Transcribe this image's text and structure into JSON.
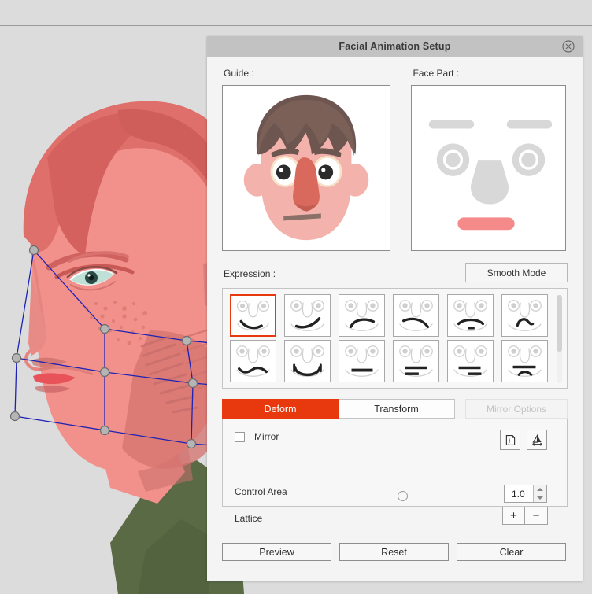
{
  "dialog": {
    "title": "Facial Animation Setup",
    "close_icon": "close-circle-icon"
  },
  "guide": {
    "label": "Guide :",
    "image_alt": "cartoon-face-guide"
  },
  "face_part": {
    "label": "Face Part :",
    "image_alt": "face-part-selector",
    "selected_part": "mouth",
    "selected_color": "#f58a8a",
    "part_color": "#d8d8d8"
  },
  "expression": {
    "label": "Expression :",
    "smooth_mode_label": "Smooth Mode",
    "selected_index": 0,
    "items": [
      {
        "name": "smile-soft",
        "shape": "curve-down-thick-left"
      },
      {
        "name": "smile-wide",
        "shape": "curve-up-right"
      },
      {
        "name": "smirk-left",
        "shape": "arc-up-left"
      },
      {
        "name": "smirk-right",
        "shape": "arc-up-right"
      },
      {
        "name": "open-small",
        "shape": "arc-with-dot"
      },
      {
        "name": "wave-small",
        "shape": "s-curve-small"
      },
      {
        "name": "wavy-frown",
        "shape": "wave-flat"
      },
      {
        "name": "grin-teeth",
        "shape": "bracket-smile"
      },
      {
        "name": "neutral-line",
        "shape": "flat-bar"
      },
      {
        "name": "double-line",
        "shape": "double-bar-right"
      },
      {
        "name": "double-line-alt",
        "shape": "double-bar-left"
      },
      {
        "name": "line-with-curve",
        "shape": "bar-and-arc"
      }
    ]
  },
  "tabs": {
    "deform": "Deform",
    "transform": "Transform",
    "active": "Deform",
    "active_color": "#e8380d"
  },
  "mirror_options": {
    "label": "Mirror Options",
    "enabled": false
  },
  "deform_panel": {
    "mirror_label": "Mirror",
    "mirror_checked": false,
    "control_area_label": "Control Area",
    "control_area_value": "1.0",
    "slider_percent": 47,
    "lattice_label": "Lattice",
    "lattice_add": "+",
    "lattice_remove": "−",
    "copy_icon": "copy-page-icon",
    "flip_icon": "flip-horizontal-icon"
  },
  "footer": {
    "preview": "Preview",
    "reset": "Reset",
    "clear": "Clear"
  },
  "canvas": {
    "character_alt": "side-profile-portrait-with-lattice",
    "lattice_point_count": 11,
    "lattice_color": "#1f23b4",
    "lattice_point_color": "#9e9e9e",
    "skin_color": "#f2918c",
    "hair_color": "#e06f6a",
    "shirt_color": "#5a6a45"
  }
}
